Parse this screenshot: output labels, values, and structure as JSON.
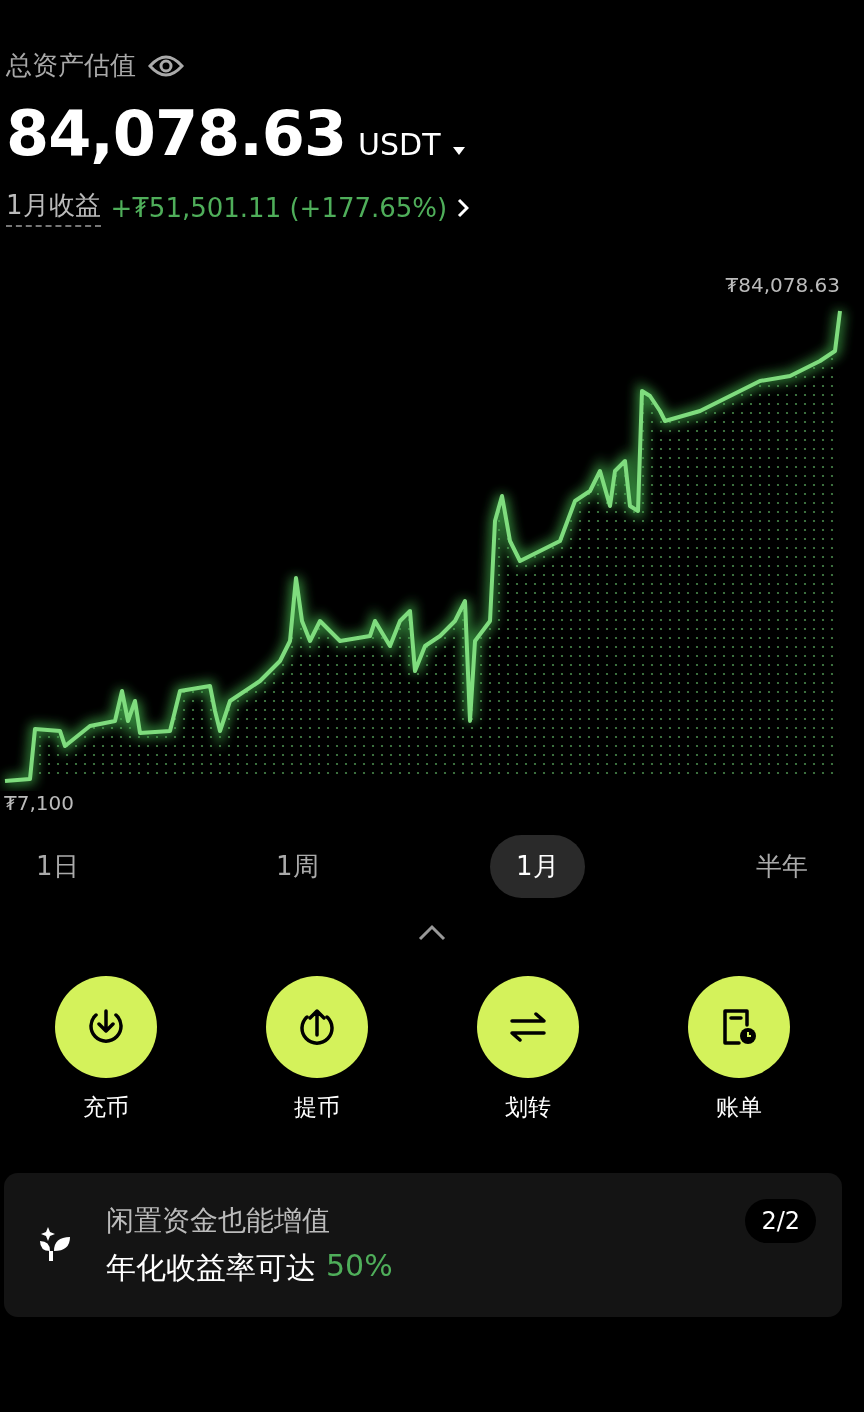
{
  "header": {
    "title": "总资产估值",
    "balance": "84,078.63",
    "currency": "USDT",
    "pnl_label": "1月收益",
    "pnl_value": "+₮51,501.11 (+177.65%)"
  },
  "chart": {
    "max_label": "₮84,078.63",
    "min_label": "₮7,100"
  },
  "ranges": [
    {
      "label": "1日",
      "selected": false
    },
    {
      "label": "1周",
      "selected": false
    },
    {
      "label": "1月",
      "selected": true
    },
    {
      "label": "半年",
      "selected": false
    }
  ],
  "actions": [
    {
      "kind": "deposit",
      "label": "充币"
    },
    {
      "kind": "withdraw",
      "label": "提币"
    },
    {
      "kind": "transfer",
      "label": "划转"
    },
    {
      "kind": "bill",
      "label": "账单"
    }
  ],
  "promo": {
    "title": "闲置资金也能增值",
    "subtitle": "年化收益率可达",
    "highlight": "50%",
    "counter": "2/2"
  }
}
